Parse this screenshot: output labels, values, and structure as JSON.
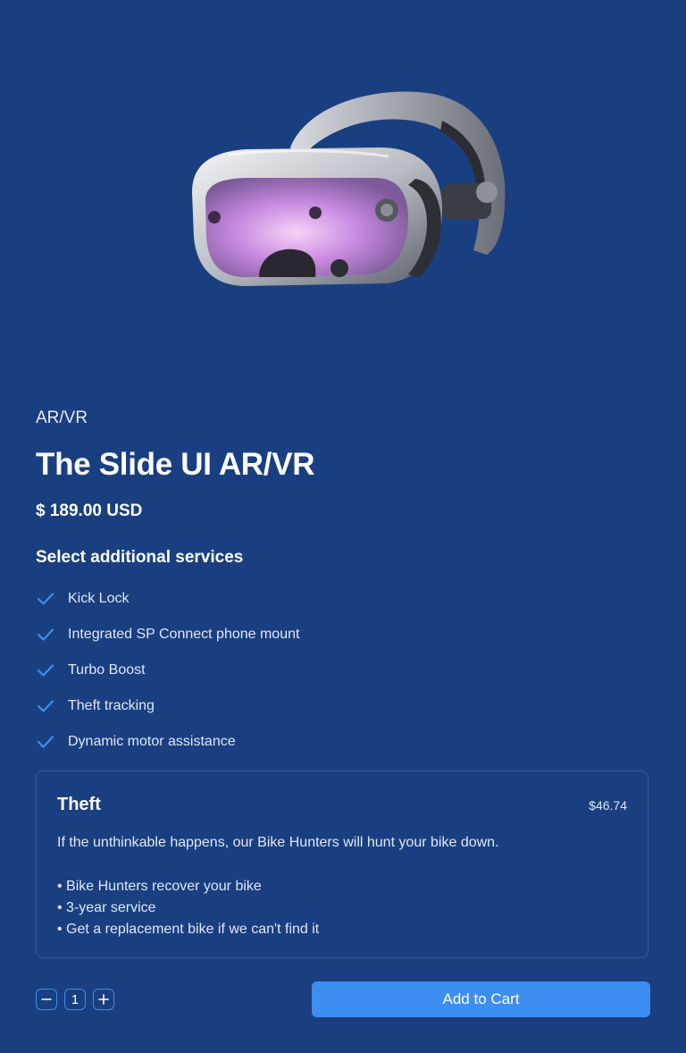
{
  "product": {
    "category": "AR/VR",
    "title": "The Slide UI AR/VR",
    "price": "$ 189.00 USD",
    "image_icon": "vr-headset-icon"
  },
  "services": {
    "heading": "Select additional services",
    "items": [
      {
        "label": "Kick Lock",
        "selected": true
      },
      {
        "label": "Integrated SP Connect phone mount",
        "selected": true
      },
      {
        "label": "Turbo Boost",
        "selected": true
      },
      {
        "label": "Theft tracking",
        "selected": true
      },
      {
        "label": "Dynamic motor assistance",
        "selected": true
      }
    ]
  },
  "detail": {
    "title": "Theft",
    "price": "$46.74",
    "description": "If the unthinkable happens, our Bike Hunters will hunt your bike down.",
    "bullets": [
      "• Bike Hunters recover your bike",
      "• 3-year service",
      "• Get a replacement bike if we can't find it"
    ]
  },
  "quantity": {
    "value": "1",
    "decrement_icon": "minus-icon",
    "increment_icon": "plus-icon"
  },
  "cart": {
    "button_label": "Add to Cart"
  },
  "colors": {
    "background": "#1a3f80",
    "accent": "#3d8ef0",
    "card_border": "#2f5aa3",
    "text_muted": "#dfe7f5"
  }
}
